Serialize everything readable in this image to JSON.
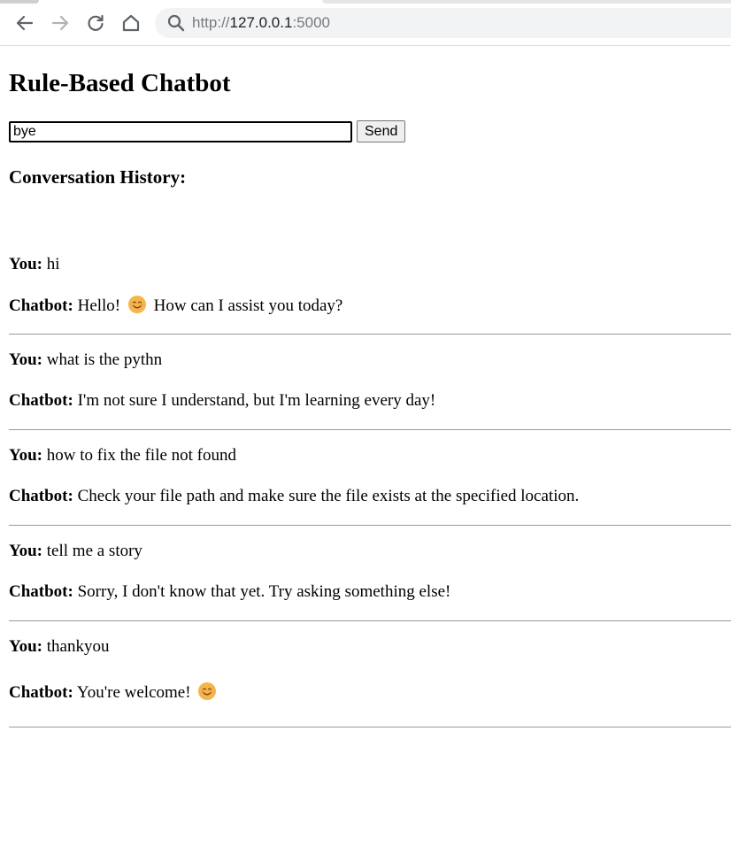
{
  "browser": {
    "url_scheme": "http://",
    "url_host": "127.0.0.1",
    "url_port": ":5000",
    "icons": [
      "back-icon",
      "forward-icon",
      "reload-icon",
      "home-icon",
      "search-icon"
    ]
  },
  "page": {
    "title": "Rule-Based Chatbot",
    "input_value": "bye",
    "send_label": "Send",
    "history_heading": "Conversation History:"
  },
  "labels": {
    "you": "You:",
    "bot": "Chatbot:"
  },
  "history": [
    {
      "user": "hi",
      "bot_before": "Hello! ",
      "bot_emoji": "smiling-face-emoji",
      "bot_after": " How can I assist you today?"
    },
    {
      "user": "what is the pythn",
      "bot_before": "I'm not sure I understand, but I'm learning every day!"
    },
    {
      "user": "how to fix the file not found",
      "bot_before": "Check your file path and make sure the file exists at the specified location."
    },
    {
      "user": "tell me a story",
      "bot_before": "Sorry, I don't know that yet. Try asking something else!"
    },
    {
      "user": "thankyou",
      "bot_before": "You're welcome! ",
      "bot_emoji": "smiling-face-emoji",
      "bot_after": ""
    }
  ],
  "colors": {
    "emoji": "#f6b54a",
    "divider": "#9a9a9a",
    "omnibox": "#f1f3f4"
  }
}
